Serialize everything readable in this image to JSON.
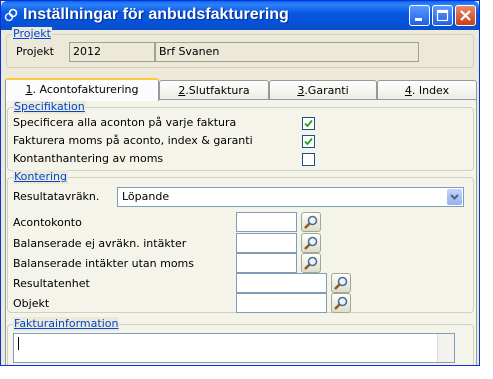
{
  "window": {
    "title": "Inställningar för anbudsfakturering",
    "icon": "app-icon"
  },
  "projekt": {
    "legend": "Projekt",
    "label": "Projekt",
    "number": "2012",
    "name": "Brf Svanen"
  },
  "tabs": [
    {
      "key": "1",
      "label": ". Acontofakturering",
      "active": true
    },
    {
      "key": "2",
      "label": ".Slutfaktura",
      "active": false
    },
    {
      "key": "3",
      "label": ".Garanti",
      "active": false
    },
    {
      "key": "4",
      "label": ". Index",
      "active": false
    }
  ],
  "specifikation": {
    "legend": "Specifikation",
    "items": [
      {
        "label": "Specificera alla aconton på varje faktura",
        "checked": true
      },
      {
        "label": "Fakturera moms på aconto, index & garanti",
        "checked": true
      },
      {
        "label": "Kontanthantering av moms",
        "checked": false
      }
    ]
  },
  "kontering": {
    "legend": "Kontering",
    "resultat_label": "Resultatavräkn.",
    "resultat_value": "Löpande",
    "fields": [
      {
        "label": "Acontokonto",
        "value": ""
      },
      {
        "label": "Balanserade ej avräkn. intäkter",
        "value": ""
      },
      {
        "label": "Balanserade intäkter utan moms",
        "value": ""
      },
      {
        "label": "Resultatenhet",
        "value": ""
      },
      {
        "label": "Objekt",
        "value": ""
      }
    ]
  },
  "fakturainformation": {
    "legend": "Fakturainformation",
    "text": ""
  },
  "colors": {
    "titlebar": "#0a58e4",
    "accent_tab": "#ffc83c",
    "legend_text": "#0046d5",
    "check": "#21a121"
  }
}
